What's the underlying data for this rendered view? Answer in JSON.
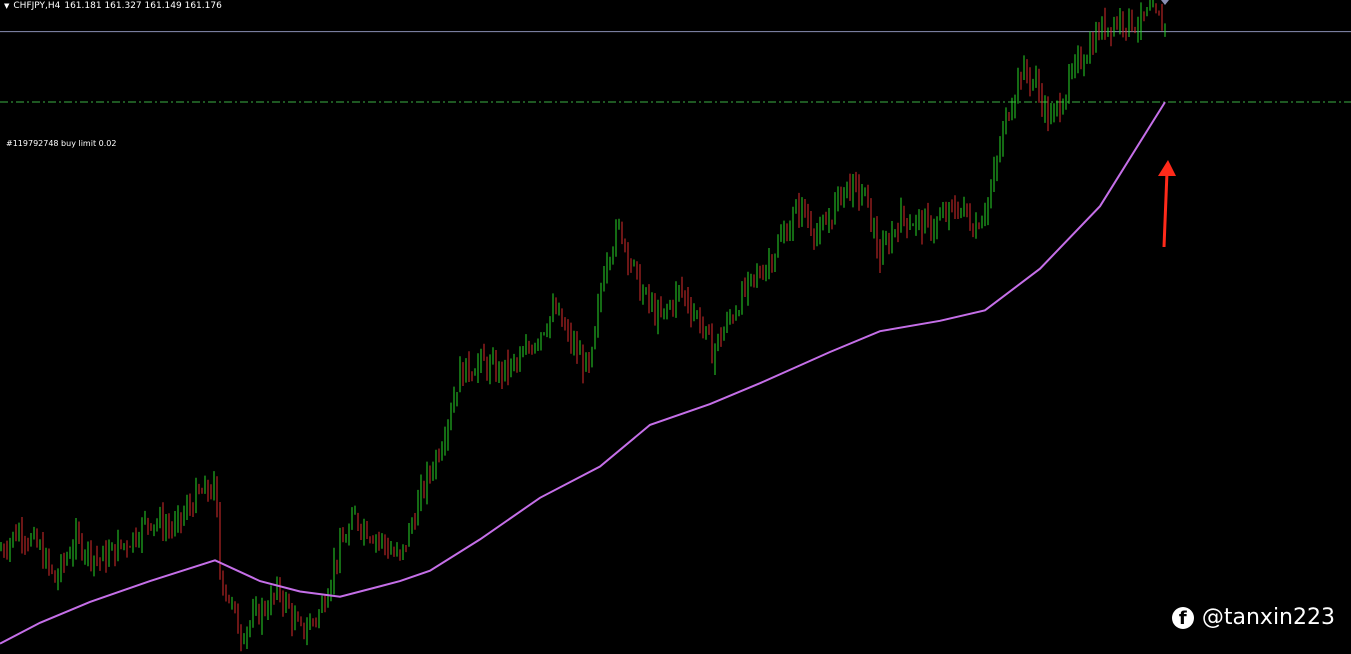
{
  "header": {
    "symbol": "CHFJPY,H4",
    "ohlc": "161.181 161.327 161.149 161.176",
    "menu_icon": "triangle-down-icon"
  },
  "order": {
    "label": "#119792748 buy limit 0.02",
    "color": "#3cb043"
  },
  "watermark": {
    "icon": "facebook-icon",
    "text": "@tanxin223"
  },
  "colors": {
    "background": "#000000",
    "bull": "#29d629",
    "bear": "#d92b2b",
    "ma": "#c56fe8",
    "price_line": "#8a8fb5",
    "arrow": "#ff2a1a"
  },
  "chart_data": {
    "type": "candlestick",
    "title": "CHFJPY,H4",
    "bid_line": 161.176,
    "buy_limit": 160.5,
    "ylim": [
      155.2,
      161.48
    ],
    "price_path": [
      [
        0,
        156.2
      ],
      [
        20,
        156.4
      ],
      [
        40,
        156.2
      ],
      [
        55,
        155.9
      ],
      [
        75,
        156.3
      ],
      [
        100,
        156.1
      ],
      [
        130,
        156.3
      ],
      [
        150,
        156.5
      ],
      [
        175,
        156.4
      ],
      [
        195,
        156.7
      ],
      [
        215,
        156.8
      ],
      [
        220,
        156.0
      ],
      [
        240,
        155.4
      ],
      [
        260,
        155.6
      ],
      [
        280,
        155.8
      ],
      [
        300,
        155.4
      ],
      [
        320,
        155.6
      ],
      [
        335,
        156.1
      ],
      [
        355,
        156.5
      ],
      [
        380,
        156.3
      ],
      [
        400,
        156.1
      ],
      [
        420,
        156.7
      ],
      [
        440,
        157.2
      ],
      [
        460,
        157.9
      ],
      [
        480,
        158.0
      ],
      [
        500,
        157.9
      ],
      [
        520,
        158.0
      ],
      [
        540,
        158.3
      ],
      [
        555,
        158.5
      ],
      [
        570,
        158.2
      ],
      [
        590,
        157.9
      ],
      [
        605,
        159.0
      ],
      [
        620,
        159.3
      ],
      [
        640,
        158.7
      ],
      [
        660,
        158.4
      ],
      [
        680,
        158.7
      ],
      [
        700,
        158.4
      ],
      [
        712,
        158.1
      ],
      [
        740,
        158.6
      ],
      [
        770,
        159.0
      ],
      [
        800,
        159.5
      ],
      [
        820,
        159.2
      ],
      [
        845,
        159.7
      ],
      [
        865,
        159.6
      ],
      [
        880,
        159.0
      ],
      [
        900,
        159.4
      ],
      [
        930,
        159.3
      ],
      [
        960,
        159.5
      ],
      [
        975,
        159.3
      ],
      [
        990,
        159.6
      ],
      [
        1005,
        160.3
      ],
      [
        1020,
        160.8
      ],
      [
        1035,
        160.7
      ],
      [
        1050,
        160.3
      ],
      [
        1065,
        160.6
      ],
      [
        1080,
        160.9
      ],
      [
        1100,
        161.2
      ],
      [
        1120,
        161.3
      ],
      [
        1140,
        161.25
      ],
      [
        1150,
        161.35
      ],
      [
        1165,
        161.22
      ]
    ],
    "ma_path": [
      [
        0,
        155.3
      ],
      [
        40,
        155.5
      ],
      [
        90,
        155.7
      ],
      [
        150,
        155.9
      ],
      [
        215,
        156.1
      ],
      [
        260,
        155.9
      ],
      [
        300,
        155.8
      ],
      [
        340,
        155.75
      ],
      [
        400,
        155.9
      ],
      [
        430,
        156.0
      ],
      [
        480,
        156.3
      ],
      [
        540,
        156.7
      ],
      [
        600,
        157.0
      ],
      [
        650,
        157.4
      ],
      [
        710,
        157.6
      ],
      [
        760,
        157.8
      ],
      [
        830,
        158.1
      ],
      [
        880,
        158.3
      ],
      [
        940,
        158.4
      ],
      [
        985,
        158.5
      ],
      [
        1040,
        158.9
      ],
      [
        1100,
        159.5
      ],
      [
        1165,
        160.5
      ]
    ]
  }
}
